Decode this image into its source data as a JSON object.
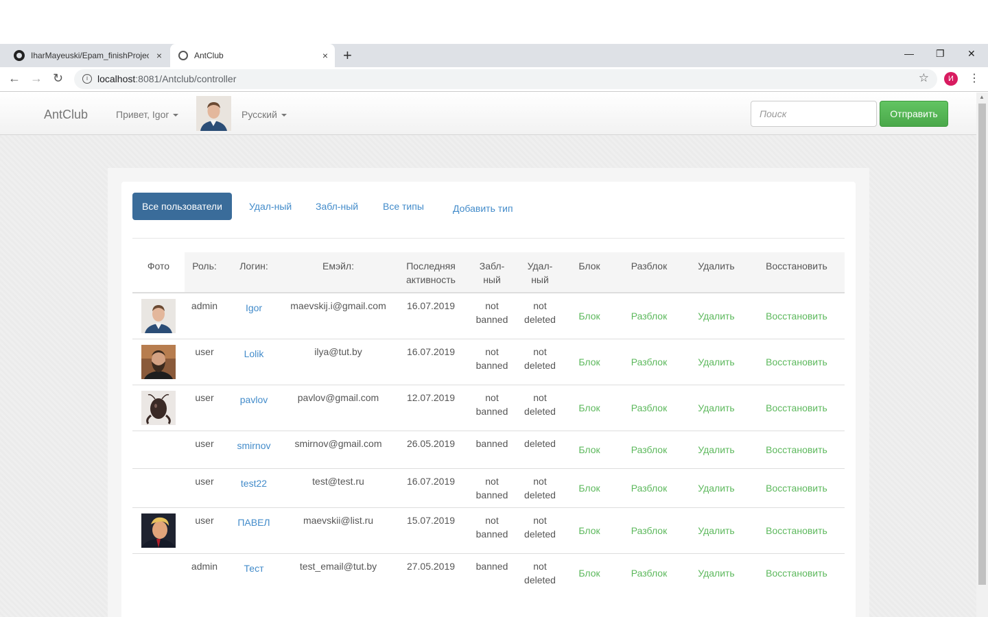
{
  "browser": {
    "tabs": [
      {
        "title": "IharMayeuski/Epam_finishProject",
        "close": "×"
      },
      {
        "title": "AntClub",
        "close": "×"
      }
    ],
    "new_tab": "+",
    "window_controls": {
      "minimize": "—",
      "restore": "❐",
      "close": "✕"
    },
    "url_host": "localhost",
    "url_rest": ":8081/Antclub/controller",
    "profile_initial": "И",
    "nav": {
      "back": "←",
      "forward": "→",
      "reload": "↻"
    }
  },
  "navbar": {
    "brand": "AntClub",
    "greeting": "Привет, Igor",
    "language": "Русский",
    "search_placeholder": "Поиск",
    "send_label": "Отправить"
  },
  "pills": {
    "all_users": "Все пользователи",
    "deleted": "Удал-ный",
    "blocked": "Забл-ный",
    "all_types": "Все типы",
    "add_type": "Добавить тип"
  },
  "table": {
    "headers": {
      "photo": "Фото",
      "role": "Роль:",
      "login": "Логин:",
      "email": "Емэйл:",
      "last_activity": "Последняя активность",
      "blocked": "Забл- ный",
      "deleted": "Удал- ный",
      "block": "Блок",
      "unblock": "Разблок",
      "remove": "Удалить",
      "restore": "Восстановить"
    },
    "actions": {
      "block": "Блок",
      "unblock": "Разблок",
      "remove": "Удалить",
      "restore": "Восстановить"
    },
    "rows": [
      {
        "photo": "man-portrait",
        "role": "admin",
        "login": "Igor",
        "email": "maevskij.i@gmail.com",
        "date": "16.07.2019",
        "banned": "not banned",
        "deleted": "not deleted"
      },
      {
        "photo": "bearded-man",
        "role": "user",
        "login": "Lolik",
        "email": "ilya@tut.by",
        "date": "16.07.2019",
        "banned": "not banned",
        "deleted": "not deleted"
      },
      {
        "photo": "ant-head",
        "role": "user",
        "login": "pavlov",
        "email": "pavlov@gmail.com",
        "date": "12.07.2019",
        "banned": "not banned",
        "deleted": "not deleted"
      },
      {
        "photo": "",
        "role": "user",
        "login": "smirnov",
        "email": "smirnov@gmail.com",
        "date": "26.05.2019",
        "banned": "banned",
        "deleted": "deleted"
      },
      {
        "photo": "",
        "role": "user",
        "login": "test22",
        "email": "test@test.ru",
        "date": "16.07.2019",
        "banned": "not banned",
        "deleted": "not deleted"
      },
      {
        "photo": "blond-man",
        "role": "user",
        "login": "ПАВЕЛ",
        "email": "maevskii@list.ru",
        "date": "15.07.2019",
        "banned": "not banned",
        "deleted": "not deleted"
      },
      {
        "photo": "",
        "role": "admin",
        "login": "Тест",
        "email": "test_email@tut.by",
        "date": "27.05.2019",
        "banned": "banned",
        "deleted": "not deleted"
      }
    ]
  }
}
